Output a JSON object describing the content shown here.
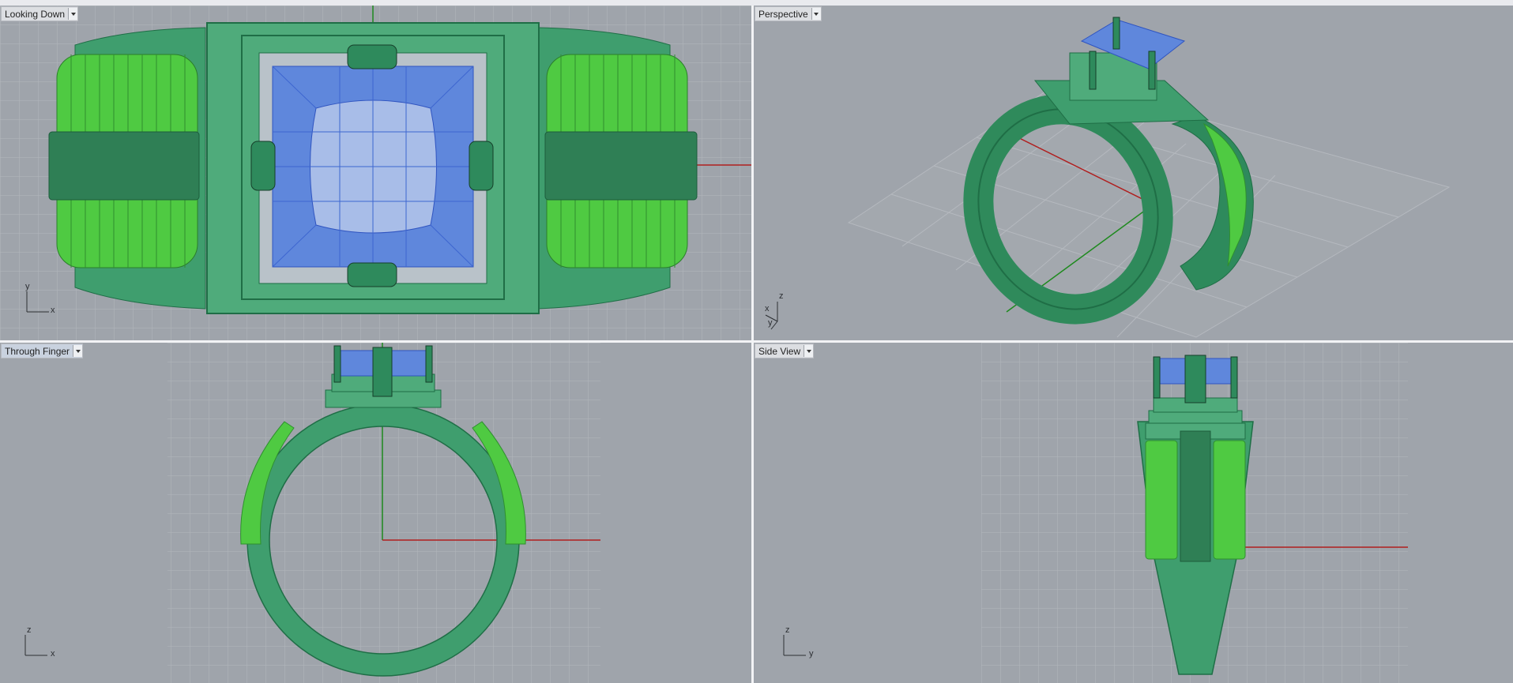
{
  "viewports": {
    "top": {
      "name": "Looking Down",
      "axis_labels": [
        "y",
        "x"
      ]
    },
    "persp": {
      "name": "Perspective",
      "axis_labels": [
        "z",
        "x",
        "y"
      ]
    },
    "front": {
      "name": "Through Finger",
      "axis_labels": [
        "z",
        "x"
      ]
    },
    "side": {
      "name": "Side View",
      "axis_labels": [
        "z",
        "y"
      ]
    }
  },
  "colors": {
    "viewport_bg": "#9fa4ab",
    "metal": "#3f9e6e",
    "metal_dark": "#1f6e46",
    "gems": "#34e83c",
    "stone": "#6b8fe0",
    "grid": "#b3b7bd",
    "axis_x": "#b01e1e",
    "axis_y": "#1e8a1e"
  }
}
